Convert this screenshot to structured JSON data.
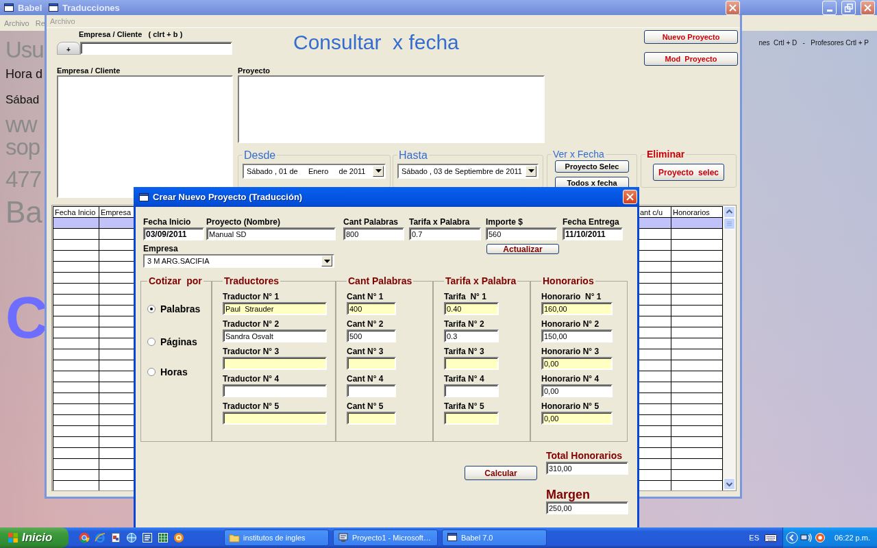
{
  "babel_window": {
    "title": "Babel",
    "menu": [
      "Archivo",
      "Re"
    ],
    "side_texts": [
      {
        "text": "Usu",
        "kind": "large"
      },
      {
        "text": "Hora d",
        "kind": "plain"
      },
      {
        "text": "Sábad",
        "kind": "plain2"
      },
      {
        "text": "ww",
        "kind": "large"
      },
      {
        "text": "sop",
        "kind": "large2"
      },
      {
        "text": "477",
        "kind": "large3"
      },
      {
        "text": "Ba",
        "kind": "big"
      },
      {
        "text": "C",
        "kind": "banner"
      }
    ],
    "shortcuts": "nes  Crtl + D   -   Profesores Crtl + P"
  },
  "traducciones_window": {
    "title": "Traducciones",
    "menu": [
      {
        "label": "Archivo",
        "disabled": true
      }
    ],
    "search": {
      "label": "Empresa / Cliente   ( clrt + b )",
      "button": "+"
    },
    "heading": "Consultar  x fecha",
    "actions": [
      "Nuevo Proyecto",
      "Mod  Proyecto"
    ],
    "client_list": {
      "label": "Empresa / Cliente"
    },
    "project_box": {
      "label": "Proyecto"
    },
    "desde": {
      "legend": "Desde",
      "value": "Sábado , 01 de     Enero     de 2011"
    },
    "hasta": {
      "legend": "Hasta",
      "value": "Sábado , 03 de Septiembre de 2011"
    },
    "ver_x_fecha": {
      "legend": "Ver x Fecha",
      "buttons": [
        "Proyecto Selec",
        "Todos x fecha"
      ]
    },
    "eliminar": {
      "legend": "Eliminar",
      "button": "Proyecto  selec"
    },
    "table": {
      "columns": [
        "Fecha Inicio",
        "Empresa",
        "ant c/u",
        "Honorarios"
      ],
      "rows": [
        {
          "selected": true
        },
        {
          "selected": false
        },
        {
          "selected": false
        },
        {
          "selected": false
        },
        {
          "selected": false
        },
        {
          "selected": false
        },
        {
          "selected": false
        },
        {
          "selected": false
        },
        {
          "selected": false
        },
        {
          "selected": false
        },
        {
          "selected": false
        },
        {
          "selected": false
        },
        {
          "selected": false
        },
        {
          "selected": false
        },
        {
          "selected": false
        },
        {
          "selected": false
        },
        {
          "selected": false
        },
        {
          "selected": false
        },
        {
          "selected": false
        },
        {
          "selected": false
        },
        {
          "selected": false
        },
        {
          "selected": false
        },
        {
          "selected": false
        },
        {
          "selected": false
        },
        {
          "selected": false
        }
      ]
    }
  },
  "dialog": {
    "title": "Crear Nuevo Proyecto (Traducción)",
    "fields": [
      {
        "label": "Fecha Inicio",
        "value": "03/09/2011",
        "kind": "date"
      },
      {
        "label": "Proyecto (Nombre)",
        "value": "Manual SD",
        "kind": "text"
      },
      {
        "label": "Cant Palabras",
        "value": "800",
        "kind": "text"
      },
      {
        "label": "Tarifa x Palabra",
        "value": "0.7",
        "kind": "text"
      },
      {
        "label": "Importe $",
        "value": "560",
        "kind": "text"
      },
      {
        "label": "Fecha Entrega",
        "value": "11/10/2011",
        "kind": "date"
      }
    ],
    "empresa": {
      "label": "Empresa",
      "value": "3 M ARG.SACIFIA"
    },
    "update_button": "Actualizar",
    "quote_by": {
      "legend": "Cotizar  por",
      "options": [
        {
          "label": "Palabras",
          "selected": true
        },
        {
          "label": "Páginas",
          "selected": false
        },
        {
          "label": "Horas",
          "selected": false
        }
      ]
    },
    "columns": [
      {
        "legend": "Traductores",
        "entries": [
          {
            "label": "Traductor N° 1",
            "value": "Paul  Strauder",
            "highlighted": true
          },
          {
            "label": "Traductor N° 2",
            "value": "Sandra Osvalt",
            "highlighted": false
          },
          {
            "label": "Traductor N° 3",
            "highlighted": true
          },
          {
            "label": "Traductor N° 4",
            "highlighted": false
          },
          {
            "label": "Traductor N° 5",
            "highlighted": true
          }
        ]
      },
      {
        "legend": "Cant Palabras",
        "entries": [
          {
            "label": "Cant N° 1",
            "value": "400",
            "highlighted": true
          },
          {
            "label": "Cant N° 2",
            "value": "500",
            "highlighted": false
          },
          {
            "label": "Cant N° 3",
            "highlighted": true
          },
          {
            "label": "Cant N° 4",
            "highlighted": false
          },
          {
            "label": "Cant N° 5",
            "highlighted": true
          }
        ]
      },
      {
        "legend": "Tarifa x Palabra",
        "entries": [
          {
            "label": "Tarifa  N° 1",
            "value": "0.40",
            "highlighted": true
          },
          {
            "label": "Tarifa N° 2",
            "value": "0.3",
            "highlighted": false
          },
          {
            "label": "Tarifa N° 3",
            "highlighted": true
          },
          {
            "label": "Tarifa N° 4",
            "highlighted": false
          },
          {
            "label": "Tarifa N° 5",
            "highlighted": true
          }
        ]
      },
      {
        "legend": "Honorarios",
        "entries": [
          {
            "label": "Honorario  N° 1",
            "value": "160,00",
            "highlighted": true
          },
          {
            "label": "Honorario N° 2",
            "value": "150,00",
            "highlighted": false
          },
          {
            "label": "Honorario N° 3",
            "value": "0,00",
            "highlighted": true
          },
          {
            "label": "Honorario N° 4",
            "value": "0,00",
            "highlighted": false
          },
          {
            "label": "Honorario N° 5",
            "value": "0,00",
            "highlighted": true
          }
        ]
      }
    ],
    "calc_button": "Calcular",
    "total": {
      "label": "Total Honorarios",
      "value": "310,00"
    },
    "margin": {
      "label": "Margen",
      "value": "250,00"
    }
  },
  "taskbar": {
    "start": "Inicio",
    "tasks": [
      {
        "label": "institutos de ingles"
      },
      {
        "label": "Proyecto1 - Microsoft…"
      },
      {
        "label": "Babel 7.0"
      }
    ],
    "language": "ES",
    "clock": "06:22 p.m."
  }
}
